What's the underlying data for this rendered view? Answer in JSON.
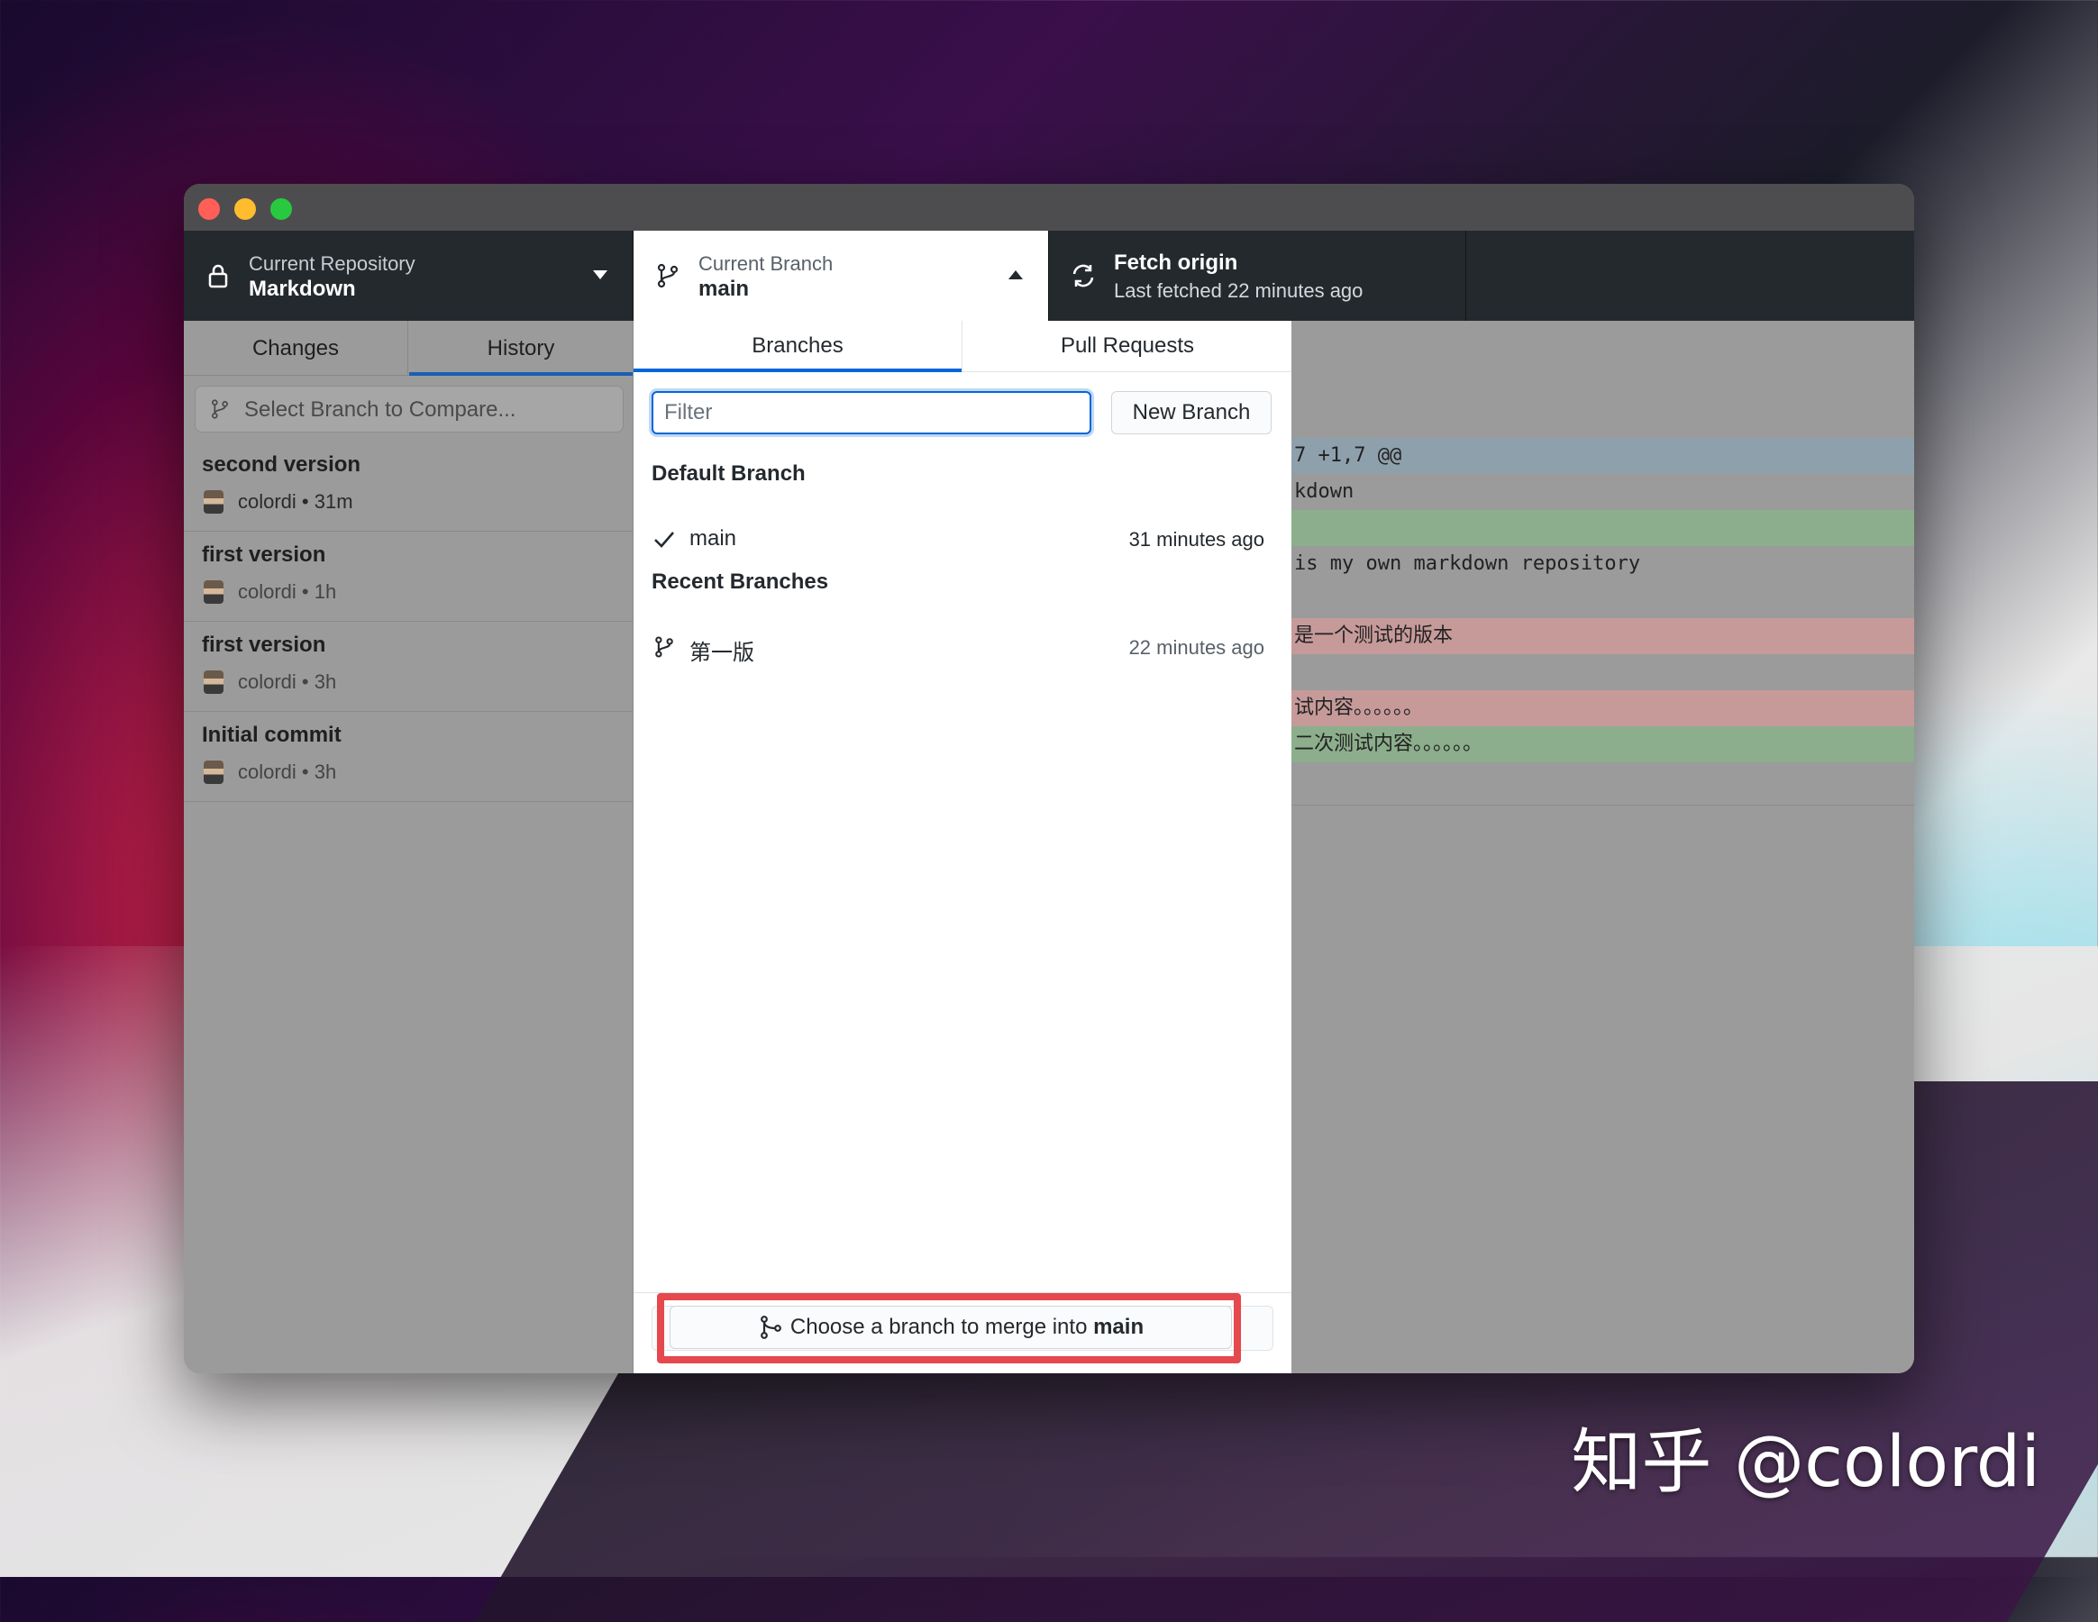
{
  "watermark": "知乎 @colordi",
  "toolbar": {
    "repo_label": "Current Repository",
    "repo_value": "Markdown",
    "branch_label": "Current Branch",
    "branch_value": "main",
    "fetch_title": "Fetch origin",
    "fetch_subtitle": "Last fetched 22 minutes ago"
  },
  "sidebar": {
    "tabs": [
      {
        "label": "Changes"
      },
      {
        "label": "History"
      }
    ],
    "compare_placeholder": "Select Branch to Compare...",
    "commits": [
      {
        "title": "second version",
        "meta": "colordi • 31m"
      },
      {
        "title": "first version",
        "meta": "colordi • 1h"
      },
      {
        "title": "first version",
        "meta": "colordi • 3h"
      },
      {
        "title": "Initial commit",
        "meta": "colordi • 3h"
      }
    ]
  },
  "diff": {
    "lines": [
      {
        "text": "7 +1,7 @@",
        "kind": "hunk"
      },
      {
        "text": "kdown",
        "kind": "ctx"
      },
      {
        "text": "",
        "kind": "add"
      },
      {
        "text": "is my own markdown repository",
        "kind": "ctx"
      },
      {
        "text": "",
        "kind": "ctx"
      },
      {
        "text": "是一个测试的版本",
        "kind": "del"
      },
      {
        "text": "",
        "kind": "ctx"
      },
      {
        "text": "试内容。。。。。。",
        "kind": "del"
      },
      {
        "text": "二次测试内容。。。。。。",
        "kind": "add"
      }
    ]
  },
  "popover": {
    "tabs": [
      {
        "label": "Branches"
      },
      {
        "label": "Pull Requests"
      }
    ],
    "filter_placeholder": "Filter",
    "new_branch_label": "New Branch",
    "default_heading": "Default Branch",
    "default_branch": {
      "name": "main",
      "time": "31 minutes ago"
    },
    "recent_heading": "Recent Branches",
    "recent_branches": [
      {
        "name": "第一版",
        "time": "22 minutes ago"
      }
    ],
    "merge_prefix": "Choose a branch to merge into ",
    "merge_branch": "main"
  },
  "colors": {
    "accent": "#0366d6",
    "highlight": "#e5484d",
    "toolbar_bg": "#24292e"
  }
}
